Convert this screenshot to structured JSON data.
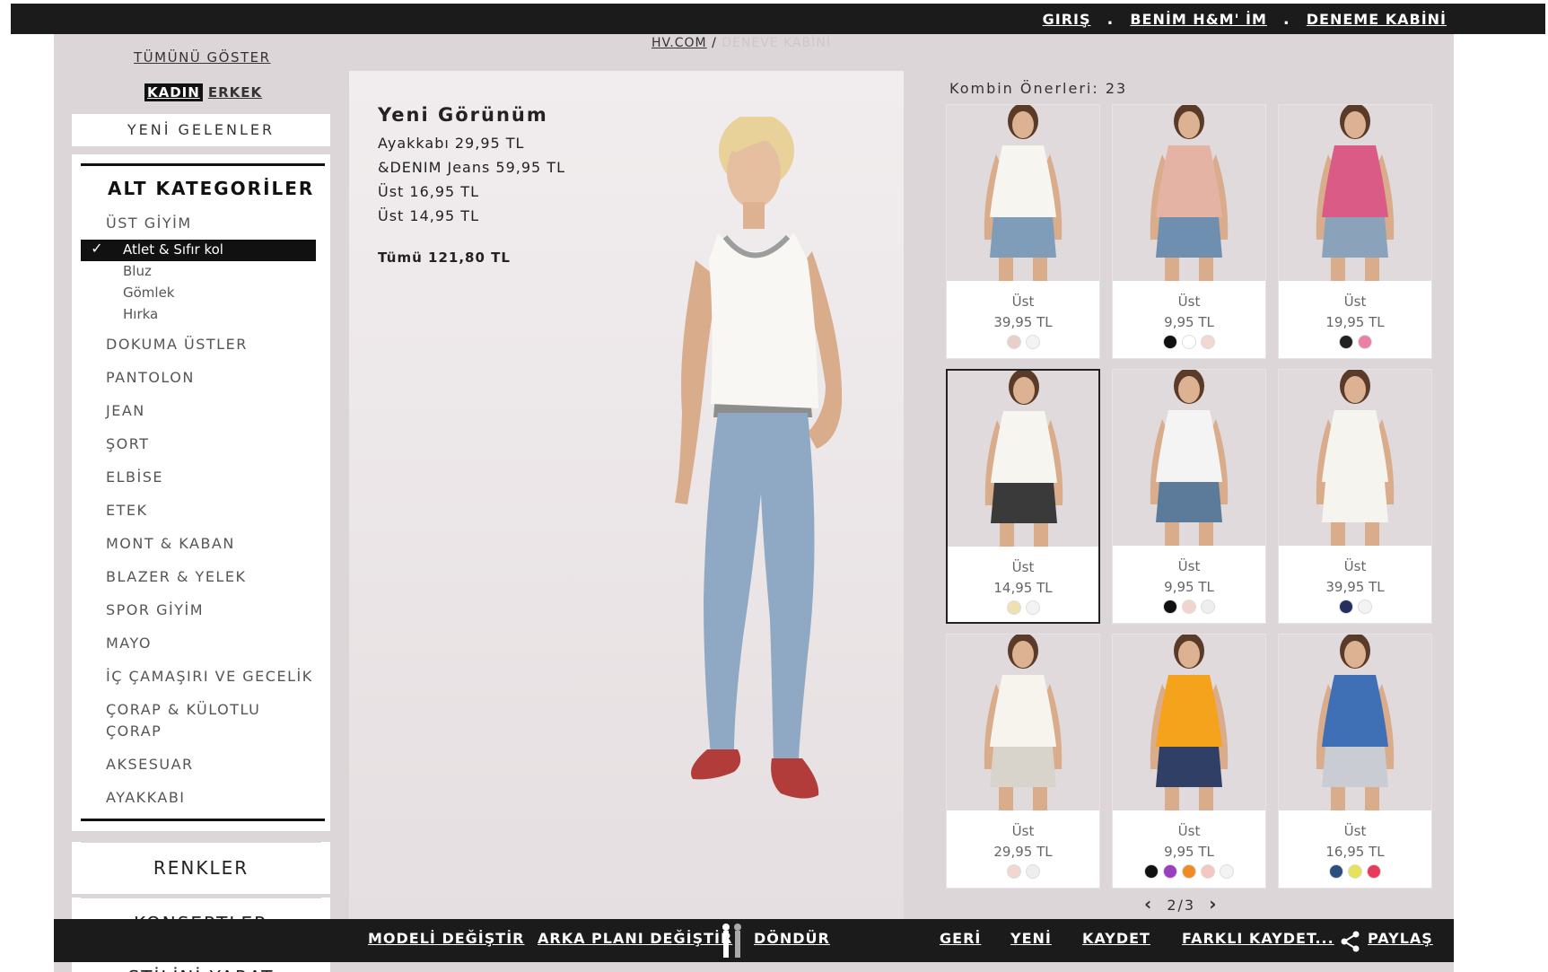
{
  "topnav": {
    "login": "GIRIŞ",
    "my_hm": "BENİM H&M' İM",
    "fitting_room": "DENEME KABİNİ",
    "separator": "."
  },
  "breadcrumb": {
    "home": "HV.COM",
    "sep": " / ",
    "current": "DENEVE KABİNİ"
  },
  "sidebar": {
    "show_all": "TÜMÜNÜ GÖSTER",
    "gender": {
      "women": "KADIN",
      "men": "ERKEK"
    },
    "new_arrivals": "YENİ GELENLER",
    "subcategories_title": "ALT KATEGORİLER",
    "items": [
      {
        "label": "ÜST GİYİM"
      },
      {
        "label": "DOKUMA ÜSTLER"
      },
      {
        "label": "PANTOLON"
      },
      {
        "label": "JEAN"
      },
      {
        "label": "ŞORT"
      },
      {
        "label": "ELBİSE"
      },
      {
        "label": "ETEK"
      },
      {
        "label": "MONT & KABAN"
      },
      {
        "label": "BLAZER & YELEK"
      },
      {
        "label": "SPOR GİYİM"
      },
      {
        "label": "MAYO"
      },
      {
        "label": "İÇ ÇAMAŞIRI VE GECELİK"
      },
      {
        "label": "ÇORAP & KÜLOTLU",
        "label2": "ÇORAP"
      },
      {
        "label": "AKSESUAR"
      },
      {
        "label": "AYAKKABI"
      }
    ],
    "sub_items": [
      {
        "label": "Atlet & Sıfır kol",
        "selected": true,
        "check": "✓"
      },
      {
        "label": "Bluz"
      },
      {
        "label": "Gömlek"
      },
      {
        "label": "Hırka"
      }
    ],
    "colors": "RENKLER",
    "concepts": "KONSEPTLER",
    "create_style": "STİLİNİ YARAT"
  },
  "look": {
    "title": "Yeni Görünüm",
    "lines": [
      "Ayakkabı 29,95 TL",
      "&DENIM Jeans 59,95 TL",
      "Üst 16,95 TL",
      "Üst 14,95 TL"
    ],
    "total": "Tümü 121,80 TL"
  },
  "combos": {
    "label": "Kombin Önerleri: 23",
    "pager": "2/3",
    "prev": "‹",
    "next": "›",
    "products": [
      {
        "name": "Üst",
        "price": "39,95 TL",
        "swatches": [
          "#e8cfcb",
          "#f3f3f3"
        ],
        "top": "#f7f5f0",
        "bottom": "#7f9db8"
      },
      {
        "name": "Üst",
        "price": "9,95 TL",
        "swatches": [
          "#111111",
          "#ffffff",
          "#f1d8d0"
        ],
        "top": "#e5b3a4",
        "bottom": "#6f8fb0"
      },
      {
        "name": "Üst",
        "price": "19,95 TL",
        "swatches": [
          "#222222",
          "#e880a8"
        ],
        "top": "#d95b86",
        "bottom": "#8aa2ba"
      },
      {
        "name": "Üst",
        "price": "14,95 TL",
        "swatches": [
          "#f0e0b0",
          "#f3f3f3"
        ],
        "top": "#f7f5f0",
        "bottom": "#3a3a3a",
        "selected": true
      },
      {
        "name": "Üst",
        "price": "9,95 TL",
        "swatches": [
          "#111111",
          "#f2d4cf",
          "#eeeeee"
        ],
        "top": "#f4f4f4",
        "bottom": "#5c7a99"
      },
      {
        "name": "Üst",
        "price": "39,95 TL",
        "swatches": [
          "#23305e",
          "#f3f3f3"
        ],
        "top": "#f6f4ee",
        "bottom": "#f6f4ee"
      },
      {
        "name": "Üst",
        "price": "29,95 TL",
        "swatches": [
          "#f2d6d0",
          "#eeeeee"
        ],
        "top": "#f7f4ee",
        "bottom": "#d8d4cc"
      },
      {
        "name": "Üst",
        "price": "9,95 TL",
        "swatches": [
          "#111111",
          "#9b3fc0",
          "#f08a24",
          "#f2c8c0",
          "#f3f3f3"
        ],
        "top": "#f5a21c",
        "bottom": "#2f3f66"
      },
      {
        "name": "Üst",
        "price": "16,95 TL",
        "swatches": [
          "#2b4f7e",
          "#e6e35a",
          "#e83a5a"
        ],
        "top": "#3f6fb5",
        "bottom": "#c9cdd3"
      }
    ]
  },
  "toolbar": {
    "change_model": "MODELİ DEĞİŞTİR",
    "change_bg": "ARKA PLANI DEĞİŞTİR",
    "rotate": "DÖNDÜR",
    "back": "GERİ",
    "new": "YENİ",
    "save": "KAYDET",
    "save_as": "FARKLI KAYDET...",
    "share": "PAYLAŞ"
  }
}
